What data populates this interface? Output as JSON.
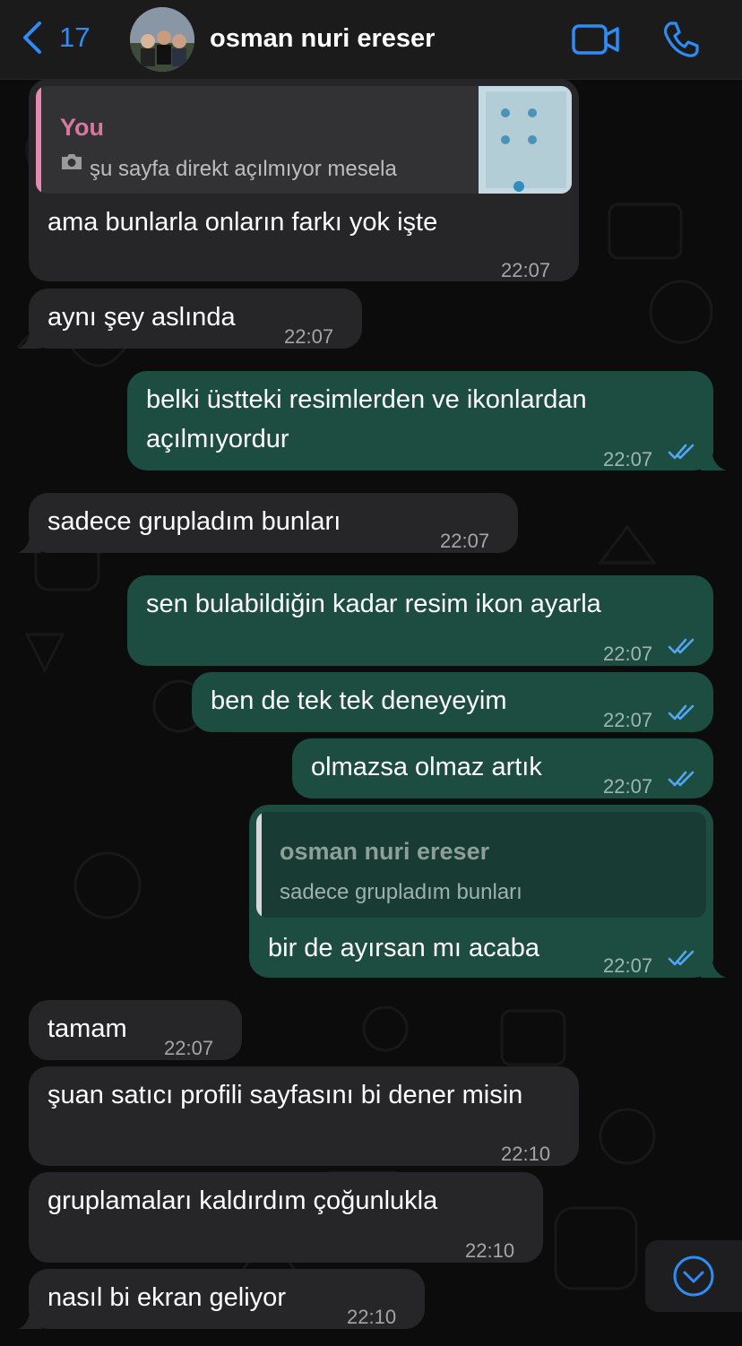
{
  "header": {
    "back_count": "17",
    "contact_name": "osman nuri ereser"
  },
  "messages": [
    {
      "dir": "in",
      "quote": {
        "author": "You",
        "text": "şu sayfa direkt açılmıyor mesela"
      },
      "text": "ama bunlarla onların farkı yok işte",
      "time": "22:07"
    },
    {
      "dir": "in",
      "text": "aynı şey aslında",
      "time": "22:07"
    },
    {
      "dir": "out",
      "text": "belki üstteki resimlerden ve ikonlardan açılmıyordur",
      "time": "22:07"
    },
    {
      "dir": "in",
      "text": "sadece grupladım bunları",
      "time": "22:07"
    },
    {
      "dir": "out",
      "text": "sen bulabildiğin kadar resim ikon ayarla",
      "time": "22:07"
    },
    {
      "dir": "out",
      "text": "ben de tek tek deneyeyim",
      "time": "22:07"
    },
    {
      "dir": "out",
      "text": "olmazsa olmaz artık",
      "time": "22:07"
    },
    {
      "dir": "out",
      "quote": {
        "author": "osman nuri ereser",
        "text": "sadece grupladım bunları"
      },
      "text": "bir de ayırsan mı acaba",
      "time": "22:07"
    },
    {
      "dir": "in",
      "text": "tamam",
      "time": "22:07"
    },
    {
      "dir": "in",
      "text": "şuan satıcı profili sayfasını bi dener misin",
      "time": "22:10"
    },
    {
      "dir": "in",
      "text": "gruplamaları kaldırdım çoğunlukla",
      "time": "22:10"
    },
    {
      "dir": "in",
      "text": "nasıl bi ekran geliyor",
      "time": "22:10"
    }
  ],
  "icons": {
    "back": "chevron-left-icon",
    "video": "video-camera-icon",
    "call": "phone-icon",
    "read": "double-check-icon",
    "photo": "camera-icon",
    "scroll": "chevron-down-circle-icon"
  },
  "colors": {
    "accent": "#2f8cf5",
    "incoming_bubble": "#262628",
    "outgoing_bubble": "#1d4d41",
    "read_ticks": "#53a6f5",
    "quote_you": "#d9789f"
  }
}
